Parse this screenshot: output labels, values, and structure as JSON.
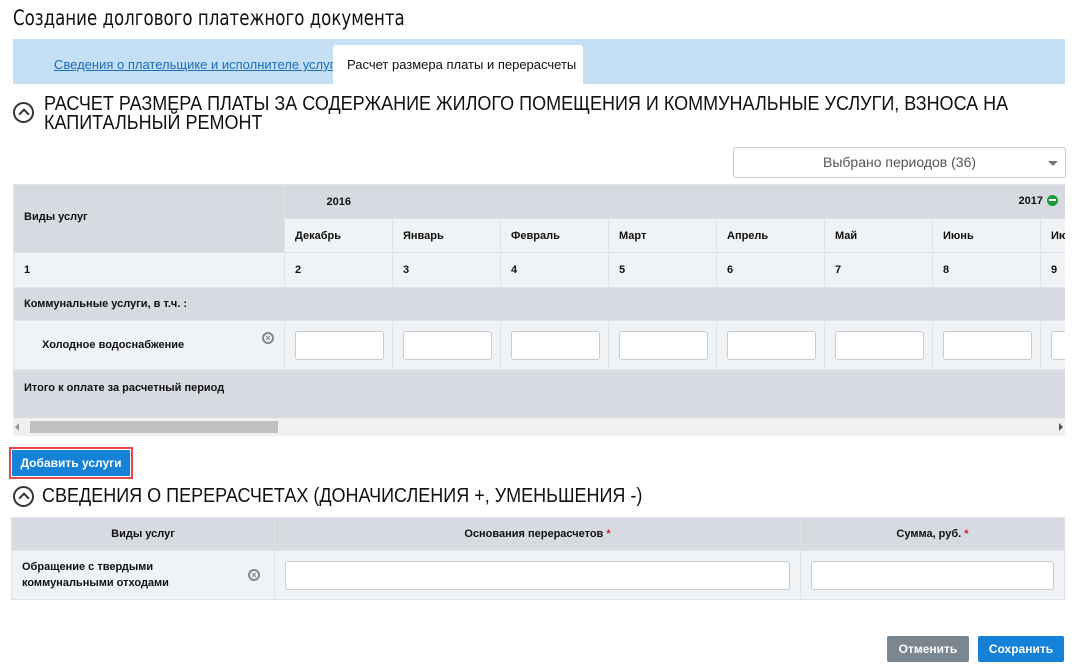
{
  "page_title": "Создание долгового платежного документа",
  "tabs": [
    {
      "label": "Сведения о плательщике и исполнителе услуг",
      "active": false
    },
    {
      "label": "Расчет размера платы и перерасчеты",
      "active": true
    }
  ],
  "section1": {
    "title_line1": "РАСЧЕТ РАЗМЕРА ПЛАТЫ ЗА СОДЕРЖАНИЕ ЖИЛОГО ПОМЕЩЕНИЯ И КОММУНАЛЬНЫЕ УСЛУГИ, ВЗНОСА НА",
    "title_line2": "КАПИТАЛЬНЫЙ РЕМОНТ",
    "period_select": "Выбрано периодов (36)",
    "grid": {
      "service_header": "Виды услуг",
      "year1": "2016",
      "year2": "2017",
      "months": [
        "Декабрь",
        "Январь",
        "Февраль",
        "Март",
        "Апрель",
        "Май",
        "Июнь",
        "Июль"
      ],
      "numbers": [
        "1",
        "2",
        "3",
        "4",
        "5",
        "6",
        "7",
        "8",
        "9"
      ],
      "group_row": "Коммунальные услуги, в т.ч. :",
      "service_row": "Холодное водоснабжение",
      "total_row": "Итого к оплате за расчетный период"
    },
    "add_button": "Добавить услуги"
  },
  "section2": {
    "title": "СВЕДЕНИЯ О ПЕРЕРАСЧЕТАХ (ДОНАЧИСЛЕНИЯ +, УМЕНЬШЕНИЯ -)",
    "headers": [
      "Виды услуг",
      "Основания перерасчетов",
      "Сумма, руб."
    ],
    "required_mark": "*",
    "row_service": "Обращение с твердыми коммунальными отходами"
  },
  "footer": {
    "cancel": "Отменить",
    "save": "Сохранить"
  },
  "colors": {
    "primary": "#1582d8",
    "tabbar": "#c5e0f5",
    "cancel": "#7b8790",
    "year_toggle": "#1a9a3a"
  }
}
